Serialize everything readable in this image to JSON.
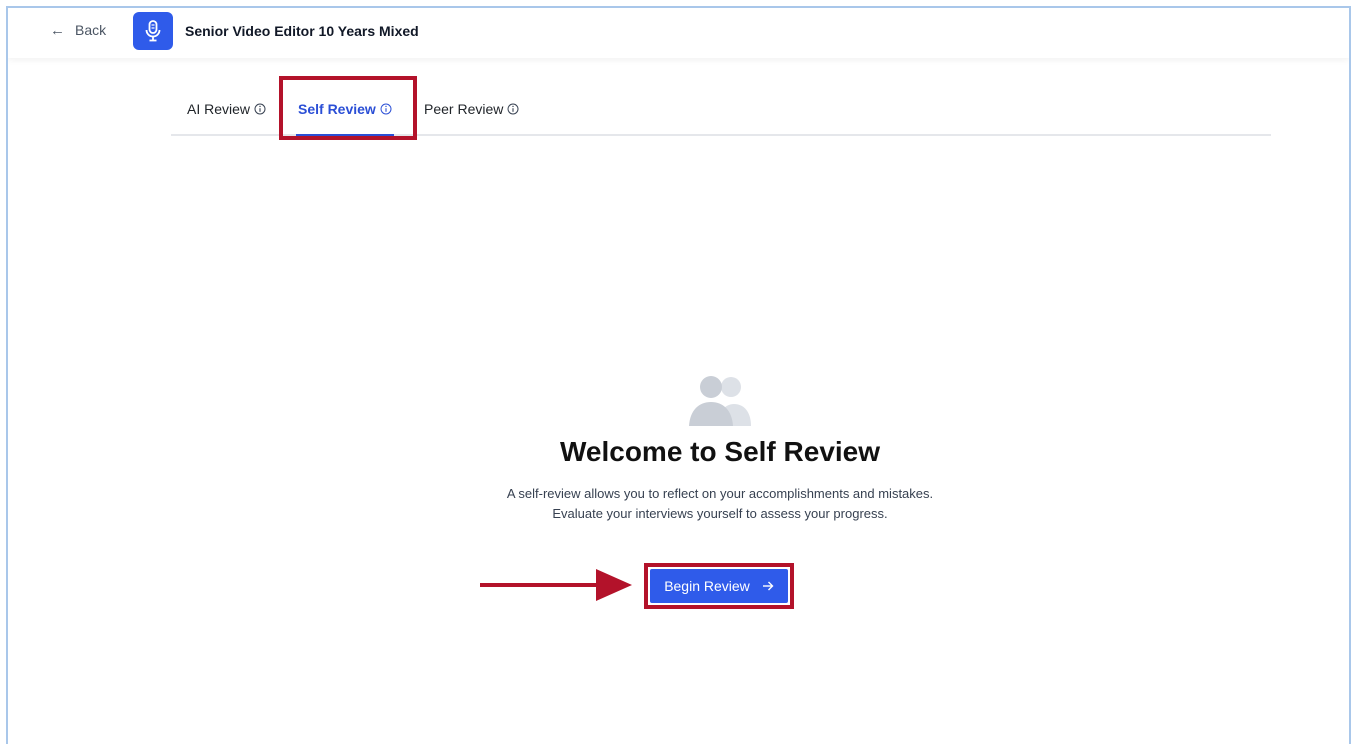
{
  "header": {
    "back_label": "Back",
    "title": "Senior Video Editor 10 Years Mixed",
    "app_icon": "microphone-icon"
  },
  "tabs": [
    {
      "label": "AI Review",
      "icon": "info-icon",
      "active": false
    },
    {
      "label": "Self Review",
      "icon": "info-icon",
      "active": true
    },
    {
      "label": "Peer Review",
      "icon": "info-icon",
      "active": false
    }
  ],
  "empty_state": {
    "icon": "users-icon",
    "title": "Welcome to Self Review",
    "description_line1": "A self-review allows you to reflect on your accomplishments and mistakes.",
    "description_line2": "Evaluate your interviews yourself to assess your progress."
  },
  "cta": {
    "label": "Begin Review",
    "icon": "arrow-right-icon"
  },
  "colors": {
    "primary": "#2f5bea",
    "active_tab": "#2b4fd6",
    "highlight": "#b3122a",
    "frame_border": "#a9c7ea"
  }
}
